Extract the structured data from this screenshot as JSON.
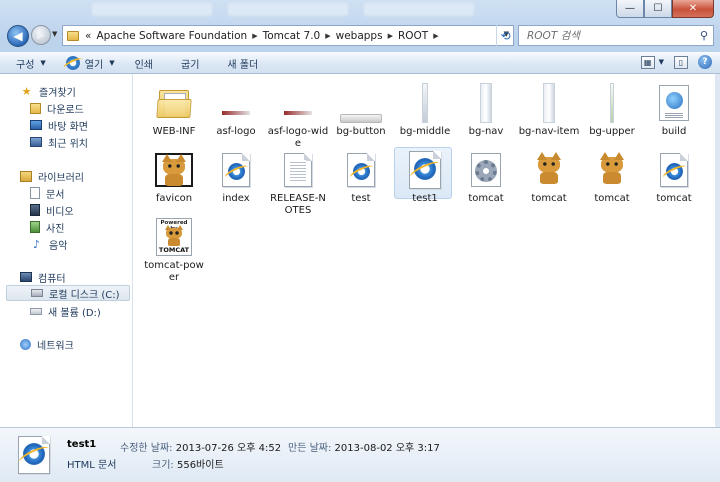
{
  "window": {
    "controls": {
      "minimize": "—",
      "maximize": "☐",
      "close": "✕"
    }
  },
  "address": {
    "crumbs": [
      "Apache Software Foundation",
      "Tomcat 7.0",
      "webapps",
      "ROOT"
    ],
    "prefix": "«",
    "separator": "▶",
    "search_placeholder": "ROOT 검색"
  },
  "toolbar": {
    "organize": "구성",
    "open": "열기",
    "print": "인쇄",
    "burn": "굽기",
    "new_folder": "새 폴더",
    "help": "?"
  },
  "sidebar": {
    "favorites": {
      "label": "즐겨찾기",
      "items": [
        "다운로드",
        "바탕 화면",
        "최근 위치"
      ]
    },
    "libraries": {
      "label": "라이브러리",
      "items": [
        "문서",
        "비디오",
        "사진",
        "음악"
      ]
    },
    "computer": {
      "label": "컴퓨터",
      "items": [
        "로컬 디스크 (C:)",
        "새 볼륨 (D:)"
      ]
    },
    "network": {
      "label": "네트워크"
    }
  },
  "files": [
    {
      "name": "WEB-INF",
      "icon": "folder-icon"
    },
    {
      "name": "asf-logo",
      "icon": "image-thin-bar-icon"
    },
    {
      "name": "asf-logo-wide",
      "icon": "image-thin-bar-icon"
    },
    {
      "name": "bg-button",
      "icon": "image-horizontal-bar-icon"
    },
    {
      "name": "bg-middle",
      "icon": "image-vertical-bar-icon"
    },
    {
      "name": "bg-nav",
      "icon": "image-vertical-bar-icon"
    },
    {
      "name": "bg-nav-item",
      "icon": "image-vertical-bar-icon"
    },
    {
      "name": "bg-upper",
      "icon": "image-vertical-bar-icon"
    },
    {
      "name": "build",
      "icon": "globe-document-icon"
    },
    {
      "name": "favicon",
      "icon": "tomcat-framed-icon"
    },
    {
      "name": "index",
      "icon": "html-document-icon"
    },
    {
      "name": "RELEASE-NOTES",
      "icon": "text-document-icon"
    },
    {
      "name": "test",
      "icon": "html-document-icon"
    },
    {
      "name": "test1",
      "icon": "html-document-icon"
    },
    {
      "name": "tomcat",
      "icon": "settings-file-icon"
    },
    {
      "name": "tomcat",
      "icon": "tomcat-cat-icon"
    },
    {
      "name": "tomcat",
      "icon": "tomcat-cat-icon"
    },
    {
      "name": "tomcat",
      "icon": "html-document-icon"
    },
    {
      "name": "tomcat-power",
      "icon": "powered-by-tomcat-icon",
      "badge_top": "Powered by",
      "badge_bottom": "TOMCAT"
    }
  ],
  "selected_file": "test1",
  "status": {
    "name": "test1",
    "type": "HTML 문서",
    "modified_label": "수정한 날짜:",
    "modified_value": "2013-07-26 오후 4:52",
    "created_label": "만든 날짜:",
    "created_value": "2013-08-02 오후 3:17",
    "size_label": "크기:",
    "size_value": "556바이트"
  }
}
